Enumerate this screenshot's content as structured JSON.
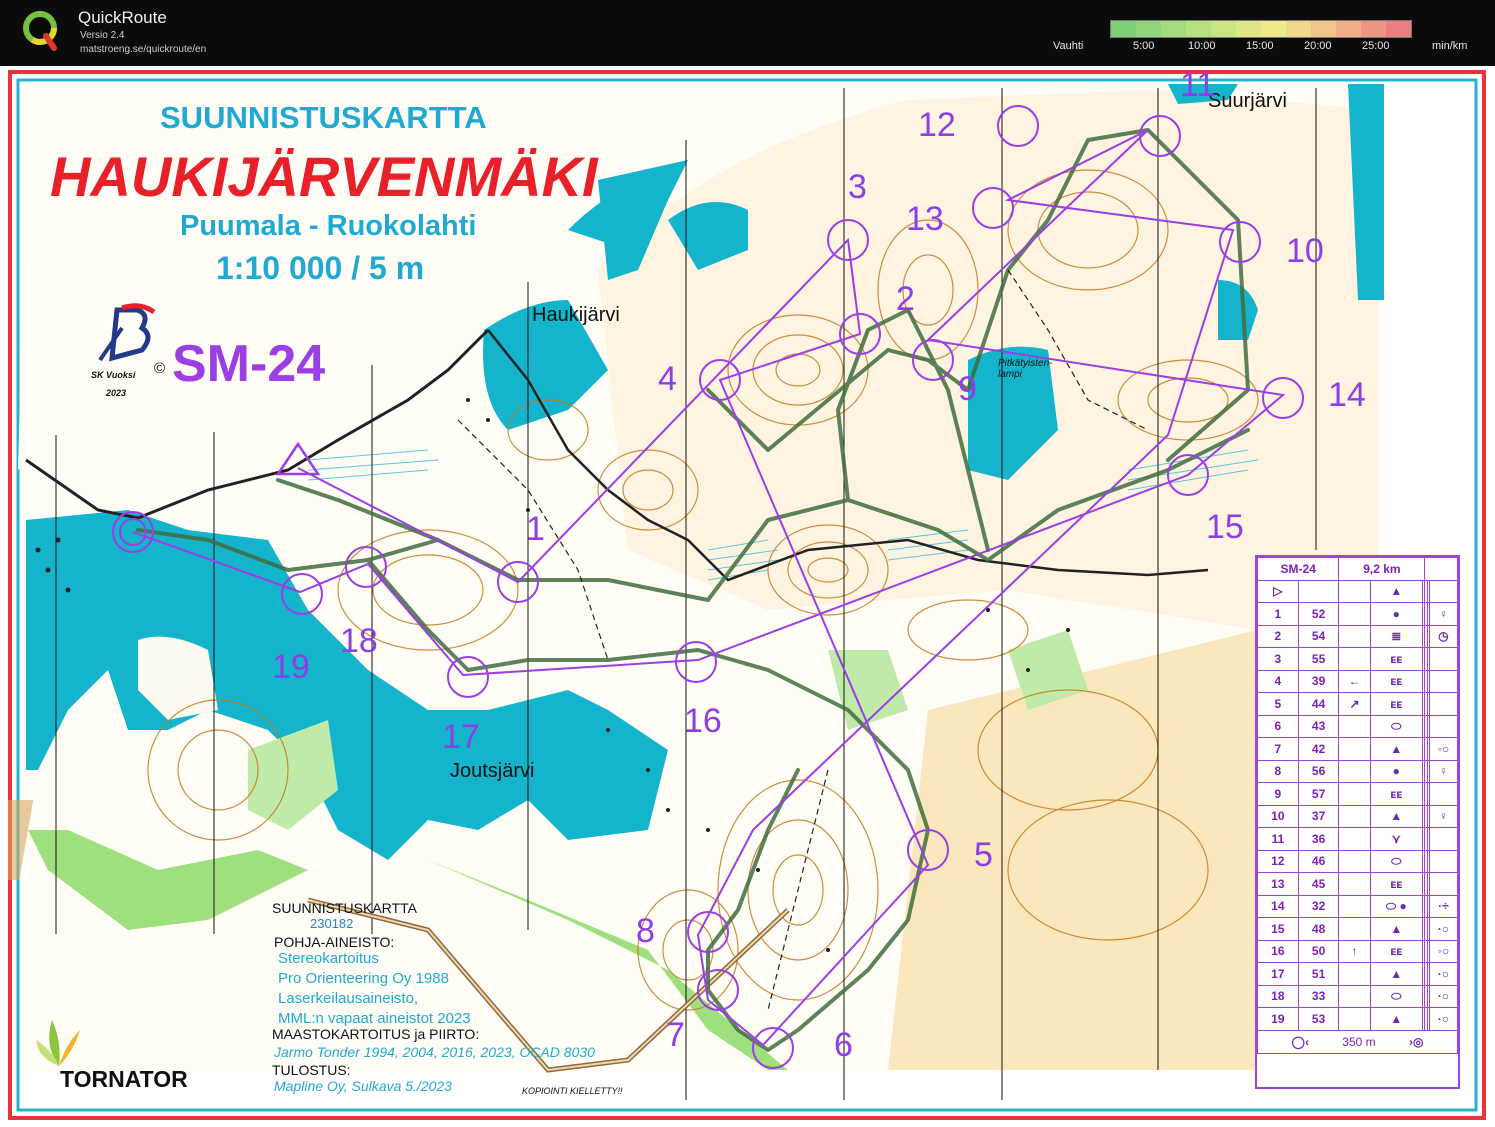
{
  "app": {
    "title": "QuickRoute",
    "version": "Versio 2.4",
    "url": "matstroeng.se/quickroute/en"
  },
  "pace_legend": {
    "label": "Vauhti",
    "ticks": [
      "5:00",
      "10:00",
      "15:00",
      "20:00",
      "25:00"
    ],
    "unit": "min/km",
    "colors": [
      "#7ed07a",
      "#8fd67c",
      "#a2dc7d",
      "#b6e180",
      "#c9e584",
      "#dde987",
      "#ecea8a",
      "#f0d98a",
      "#f2c48a",
      "#f1ad87",
      "#ef9583",
      "#ec7e80"
    ]
  },
  "map": {
    "header_line1": "SUUNNISTUSKARTTA",
    "title": "HAUKIJÄRVENMÄKI",
    "subtitle": "Puumala - Ruokolahti",
    "scale": "1:10 000 / 5 m",
    "event": "SM-24",
    "club": "SK Vuoksi",
    "club_year": "2023",
    "copyright": "©",
    "lake_names": [
      "Haukijärvi",
      "Joutsjärvi",
      "Suurjärvi",
      "Pitkätyisten-lampi"
    ],
    "sponsor": "TORNATOR",
    "colors": {
      "water": "#14b4cc",
      "course": "#9b3ee4",
      "contour": "#c47a1e",
      "path": "#3f6d3e"
    }
  },
  "credits": {
    "heading": "SUUNNISTUSKARTTA",
    "number": "230182",
    "base_heading": "POHJA-AINEISTO:",
    "base_lines": [
      "Stereokartoitus",
      "Pro Orienteering Oy 1988",
      "Laserkeilausaineisto,",
      "MML:n vapaat aineistot 2023"
    ],
    "survey_heading": "MAASTOKARTOITUS ja PIIRTO:",
    "survey_line": "Jarmo Tonder 1994, 2004, 2016, 2023, OCAD 8030",
    "print_heading": "TULOSTUS:",
    "print_line": "Mapline Oy, Sulkava 5./2023",
    "copy_notice": "KOPIOINTI KIELLETTY!!"
  },
  "controls": [
    {
      "num": "1",
      "code": "52",
      "feature": "●",
      "loc": "",
      "appear": "♀"
    },
    {
      "num": "2",
      "code": "54",
      "feature": "≣",
      "loc": "",
      "appear": "◷"
    },
    {
      "num": "3",
      "code": "55",
      "feature": "ᴇᴇ",
      "loc": "",
      "appear": ""
    },
    {
      "num": "4",
      "code": "39",
      "feature": "ᴇᴇ",
      "loc": "←",
      "appear": ""
    },
    {
      "num": "5",
      "code": "44",
      "feature": "ᴇᴇ",
      "loc": "↗",
      "appear": ""
    },
    {
      "num": "6",
      "code": "43",
      "feature": "⬭",
      "loc": "",
      "appear": ""
    },
    {
      "num": "7",
      "code": "42",
      "feature": "▲",
      "loc": "",
      "appear": "◦○"
    },
    {
      "num": "8",
      "code": "56",
      "feature": "●",
      "loc": "",
      "appear": "♀"
    },
    {
      "num": "9",
      "code": "57",
      "feature": "ᴇᴇ",
      "loc": "",
      "appear": ""
    },
    {
      "num": "10",
      "code": "37",
      "feature": "▲",
      "loc": "",
      "appear": "♀"
    },
    {
      "num": "11",
      "code": "36",
      "feature": "⋎",
      "loc": "",
      "appear": ""
    },
    {
      "num": "12",
      "code": "46",
      "feature": "⬭",
      "loc": "",
      "appear": ""
    },
    {
      "num": "13",
      "code": "45",
      "feature": "ᴇᴇ",
      "loc": "",
      "appear": ""
    },
    {
      "num": "14",
      "code": "32",
      "feature": "⬭ ●",
      "loc": "",
      "appear": "·÷"
    },
    {
      "num": "15",
      "code": "48",
      "feature": "▲",
      "loc": "",
      "appear": "·○"
    },
    {
      "num": "16",
      "code": "50",
      "feature": "ᴇᴇ",
      "loc": "↑",
      "appear": "◦○"
    },
    {
      "num": "17",
      "code": "51",
      "feature": "▲",
      "loc": "",
      "appear": "·○"
    },
    {
      "num": "18",
      "code": "33",
      "feature": "⬭",
      "loc": "",
      "appear": "·○"
    },
    {
      "num": "19",
      "code": "53",
      "feature": "▲",
      "loc": "",
      "appear": "·○"
    }
  ],
  "course": {
    "name": "SM-24",
    "length": "9,2 km",
    "finish_distance": "350 m"
  }
}
